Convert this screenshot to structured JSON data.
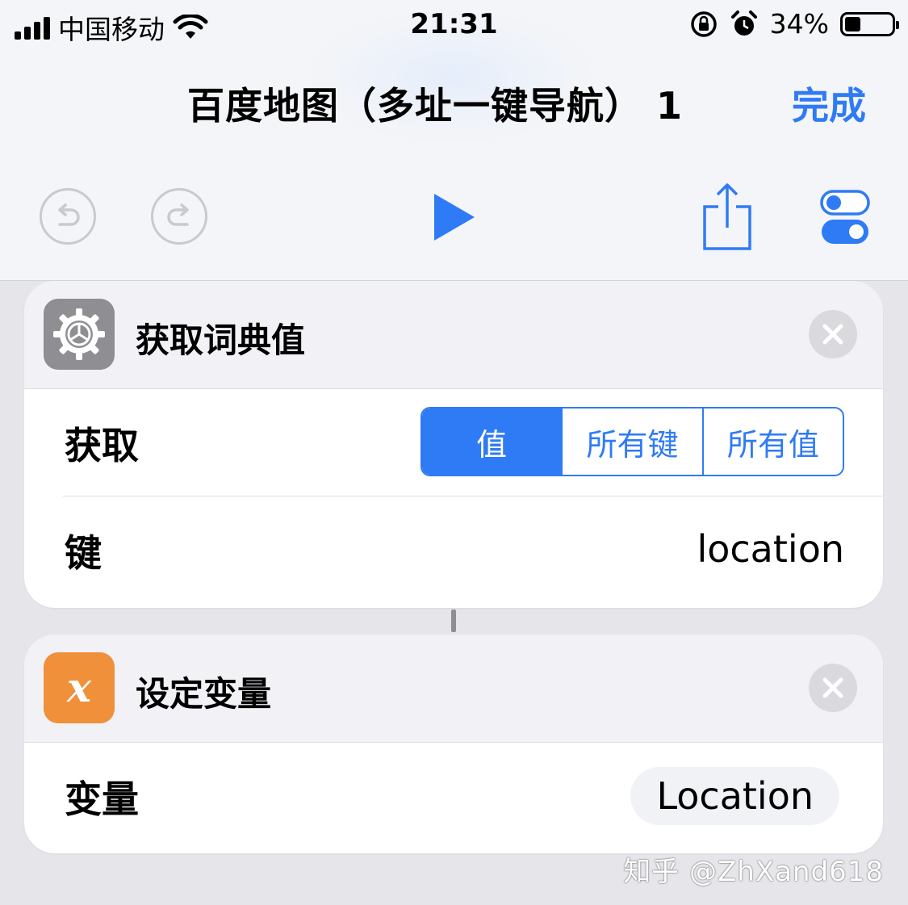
{
  "status_bar": {
    "carrier": "中国移动",
    "time": "21:31",
    "battery": "34%",
    "battery_level": 0.34
  },
  "header": {
    "title": "百度地图（多址一键导航） 1",
    "done_label": "完成"
  },
  "toolbar": {
    "undo_icon": "undo-icon",
    "redo_icon": "redo-icon",
    "run_icon": "play-icon",
    "share_icon": "share-icon",
    "settings_icon": "toggles-icon"
  },
  "actions": [
    {
      "title": "获取词典值",
      "icon": "gear-icon",
      "icon_color": "#8e8e93",
      "get_label": "获取",
      "segments": [
        "值",
        "所有键",
        "所有值"
      ],
      "selected_segment": "值",
      "key_label": "键",
      "key_value": "location"
    },
    {
      "title": "设定变量",
      "icon": "variable-icon",
      "icon_color": "#f0903a",
      "icon_glyph": "x",
      "variable_label": "变量",
      "variable_value": "Location"
    }
  ],
  "watermark": "知乎 @ZhXand618",
  "colors": {
    "accent": "#2f7bf5",
    "background": "#e5e5ea"
  }
}
